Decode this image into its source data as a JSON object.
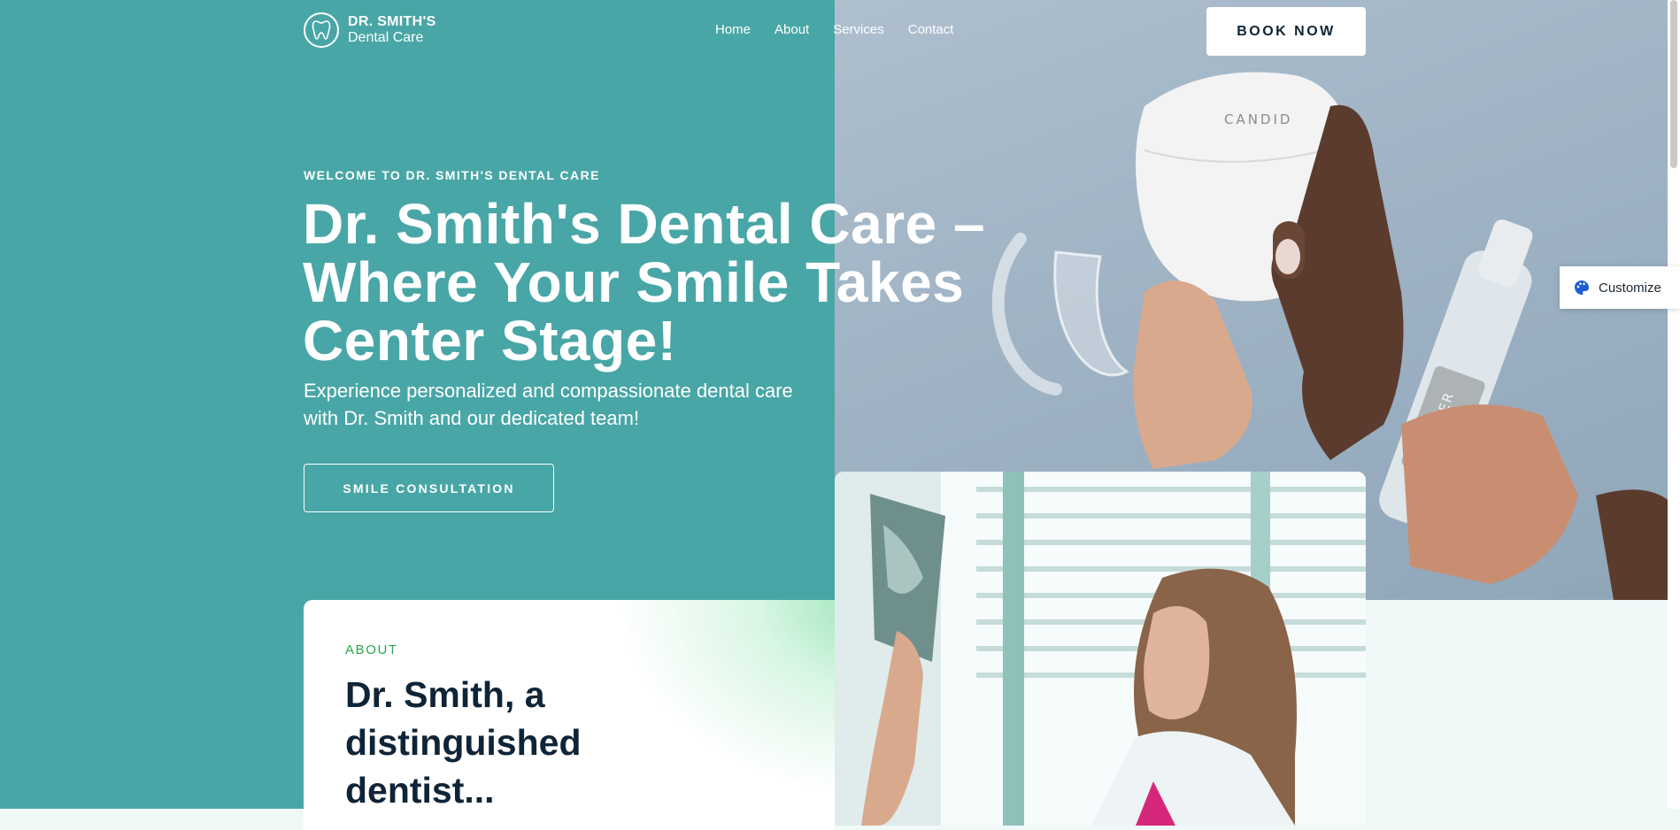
{
  "header": {
    "logo_line1": "DR. SMITH'S",
    "logo_line2": "Dental Care",
    "nav": [
      "Home",
      "About",
      "Services",
      "Contact"
    ],
    "book_label": "BOOK NOW"
  },
  "hero": {
    "eyebrow": "WELCOME TO DR. SMITH'S DENTAL CARE",
    "title": "Dr. Smith's Dental Care – Where Your Smile Takes Center Stage!",
    "subtitle": "Experience personalized and compassionate dental care with Dr. Smith and our dedicated team!",
    "cta_label": "SMILE CONSULTATION",
    "photo_case_text": "CANDID",
    "photo_bottle_text": "WHITENER"
  },
  "customize": {
    "label": "Customize"
  },
  "about": {
    "eyebrow": "ABOUT",
    "title": "Dr. Smith, a distinguished dentist..."
  },
  "colors": {
    "teal": "#49a6a6",
    "navy": "#0f2436",
    "green_accent": "#2aa64e",
    "customize_icon": "#1f5fd6"
  },
  "icons": {
    "logo": "tooth-icon",
    "customize": "palette-icon"
  }
}
